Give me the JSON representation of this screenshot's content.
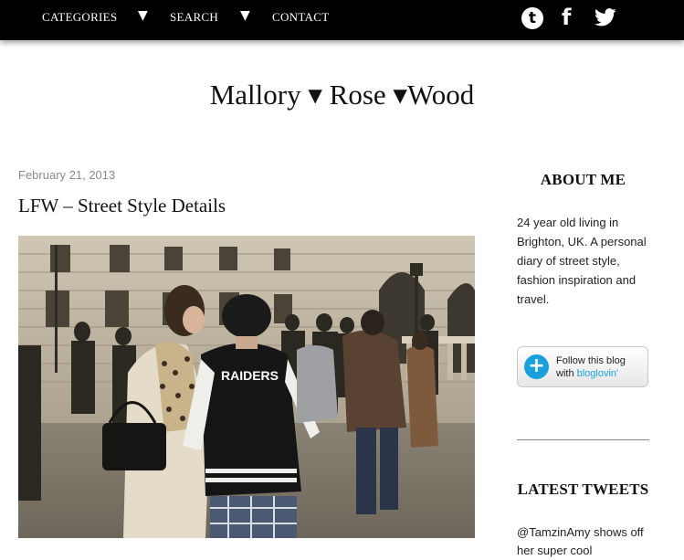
{
  "nav": {
    "categories": "CATEGORIES",
    "search": "SEARCH",
    "contact": "CONTACT",
    "arrow": "▼"
  },
  "social_icons": [
    "tumblr-icon",
    "facebook-icon",
    "twitter-icon"
  ],
  "site": {
    "title": "Mallory ▾ Rose ▾Wood"
  },
  "post": {
    "date": "February 21, 2013",
    "title": "LFW – Street Style Details",
    "jacket_text": "RAIDERS"
  },
  "sidebar": {
    "about_heading": "ABOUT ME",
    "about_text": "24 year old living in Brighton, UK. A personal diary of street style, fashion inspiration and travel.",
    "bloglovin": {
      "line1": "Follow this blog",
      "line2_prefix": "with ",
      "line2_brand": "bloglovin'"
    },
    "tweets_heading": "LATEST TWEETS",
    "tweet_text": "@TamzinAmy shows off her super cool"
  },
  "colors": {
    "nav_bg": "#000000",
    "accent_blue": "#1aa0dd",
    "date_gray": "#8a8a8a"
  }
}
